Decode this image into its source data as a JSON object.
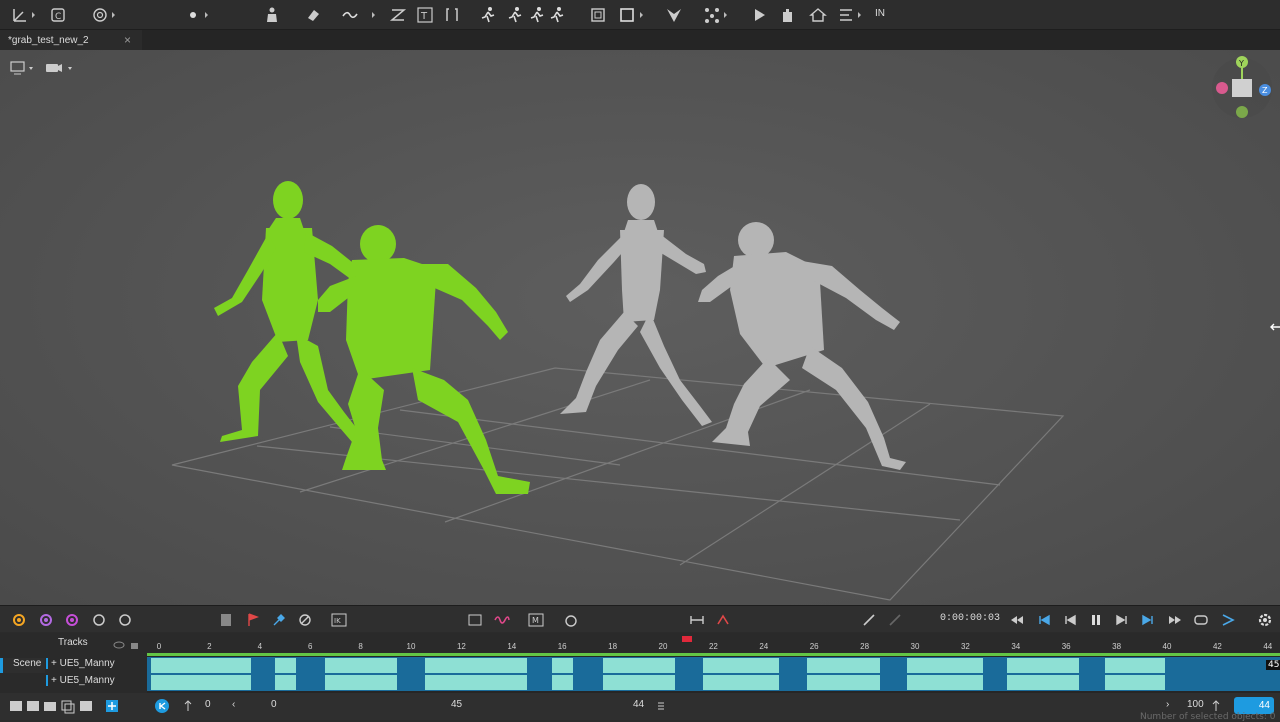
{
  "document": {
    "tab_title": "*grab_test_new_2",
    "tab_close": "×"
  },
  "toolbar": {
    "in_label": "IN"
  },
  "timeline": {
    "tracks_label": "Tracks",
    "scene_label": "Scene",
    "track_1": "+ UE5_Manny",
    "track_2": "+ UE5_Manny",
    "ticks": [
      "0",
      "2",
      "4",
      "6",
      "8",
      "10",
      "12",
      "14",
      "16",
      "18",
      "20",
      "22",
      "24",
      "26",
      "28",
      "30",
      "32",
      "34",
      "36",
      "38",
      "40",
      "42",
      "44"
    ],
    "end_frame": "45",
    "current_time": "0:00:00:03"
  },
  "footer": {
    "range_start": "0",
    "range_start_b": "0",
    "range_mid": "45",
    "range_end": "44",
    "fps": "100",
    "frame_count": "44",
    "status": "Number of selected objects: 0"
  },
  "colors": {
    "accent": "#1e9be0",
    "selection": "#7ed321",
    "track_key": "#8ee0d4",
    "track_gap": "#1a6b9a"
  }
}
